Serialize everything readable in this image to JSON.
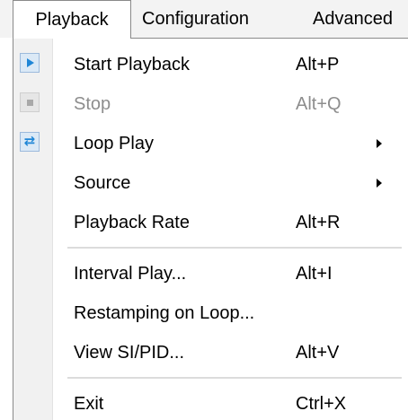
{
  "menubar": {
    "items": [
      {
        "label": "Playback",
        "active": true
      },
      {
        "label": "Configuration",
        "active": false
      },
      {
        "label": "Advanced",
        "active": false
      }
    ]
  },
  "dropdown": {
    "items": [
      {
        "label": "Start Playback",
        "shortcut": "Alt+P",
        "icon": "play-icon",
        "enabled": true,
        "submenu": false
      },
      {
        "label": "Stop",
        "shortcut": "Alt+Q",
        "icon": "stop-icon",
        "enabled": false,
        "submenu": false
      },
      {
        "label": "Loop Play",
        "shortcut": "",
        "icon": "loop-icon",
        "enabled": true,
        "submenu": true
      },
      {
        "label": "Source",
        "shortcut": "",
        "icon": "",
        "enabled": true,
        "submenu": true
      },
      {
        "label": "Playback Rate",
        "shortcut": "Alt+R",
        "icon": "",
        "enabled": true,
        "submenu": false
      },
      {
        "label": "Interval Play...",
        "shortcut": "Alt+I",
        "icon": "",
        "enabled": true,
        "submenu": false
      },
      {
        "label": "Restamping on Loop...",
        "shortcut": "",
        "icon": "",
        "enabled": true,
        "submenu": false
      },
      {
        "label": "View SI/PID...",
        "shortcut": "Alt+V",
        "icon": "",
        "enabled": true,
        "submenu": false
      },
      {
        "label": "Exit",
        "shortcut": "Ctrl+X",
        "icon": "",
        "enabled": true,
        "submenu": false
      }
    ]
  },
  "colors": {
    "menubar_bg": "#f3f3f3",
    "gutter_bg": "#f1f1f1",
    "disabled_text": "#8d8d8d",
    "icon_accent": "#1f86d6"
  }
}
